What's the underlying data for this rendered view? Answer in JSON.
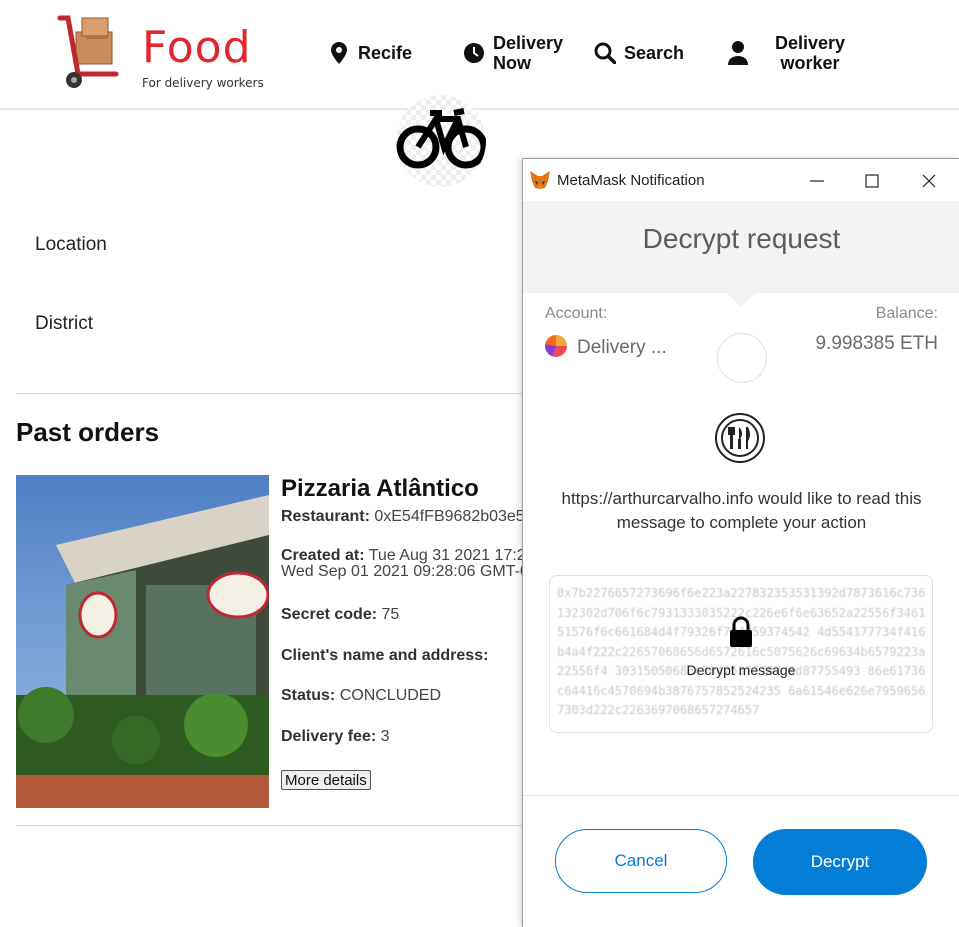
{
  "header": {
    "logo_title": "Food",
    "logo_subtitle": "For delivery workers",
    "nav": [
      {
        "label": "Recife",
        "icon": "location-pin-icon"
      },
      {
        "label_line1": "Delivery",
        "label_line2": "Now",
        "icon": "clock-icon"
      },
      {
        "label": "Search",
        "icon": "search-icon"
      },
      {
        "label_line1": "Delivery",
        "label_line2": "worker",
        "icon": "user-icon"
      }
    ]
  },
  "profile": {
    "avatar_icon": "bicycle-icon",
    "location_label": "Location",
    "district_label": "District"
  },
  "past_orders": {
    "title": "Past orders",
    "order": {
      "name": "Pizzaria Atlântico",
      "restaurant_label": "Restaurant:",
      "restaurant_value": "0xE54fFB9682b03e5A",
      "created_label": "Created at:",
      "created_value": "Tue Aug 31 2021 17:2",
      "created_value_line2": "Wed Sep 01 2021 09:28:06 GMT-0",
      "secret_label": "Secret code:",
      "secret_value": "75",
      "client_label": "Client's name and address:",
      "status_label": "Status:",
      "status_value": "CONCLUDED",
      "fee_label": "Delivery fee:",
      "fee_value": "3",
      "more_details": "More details"
    }
  },
  "metamask": {
    "window_title": "MetaMask Notification",
    "header_title": "Decrypt request",
    "account_label": "Account:",
    "account_name": "Delivery ...",
    "balance_label": "Balance:",
    "balance_value": "9.998385 ETH",
    "request_text": "https://arthurcarvalho.info would like to read this message to complete your action",
    "encrypted_message": "0x7b2276657273696f6e223a227832353531392d7873616c736132302d706f6c7931333035222c226e6f6e63652a22556f346151576f6c661684d4f79326f784759374542 4d554177734f416b4a4f222c22657068656d6572616c5075626c69634b6579223a22556f4 30315050686c50425377787 0d87755493 86e61736c64416c4570694b3876757852524235 6a61546e626e79596567303d222c2263697068657274657",
    "lock_label": "Decrypt message",
    "cancel_label": "Cancel",
    "decrypt_label": "Decrypt",
    "accent_color": "#037dd6"
  }
}
